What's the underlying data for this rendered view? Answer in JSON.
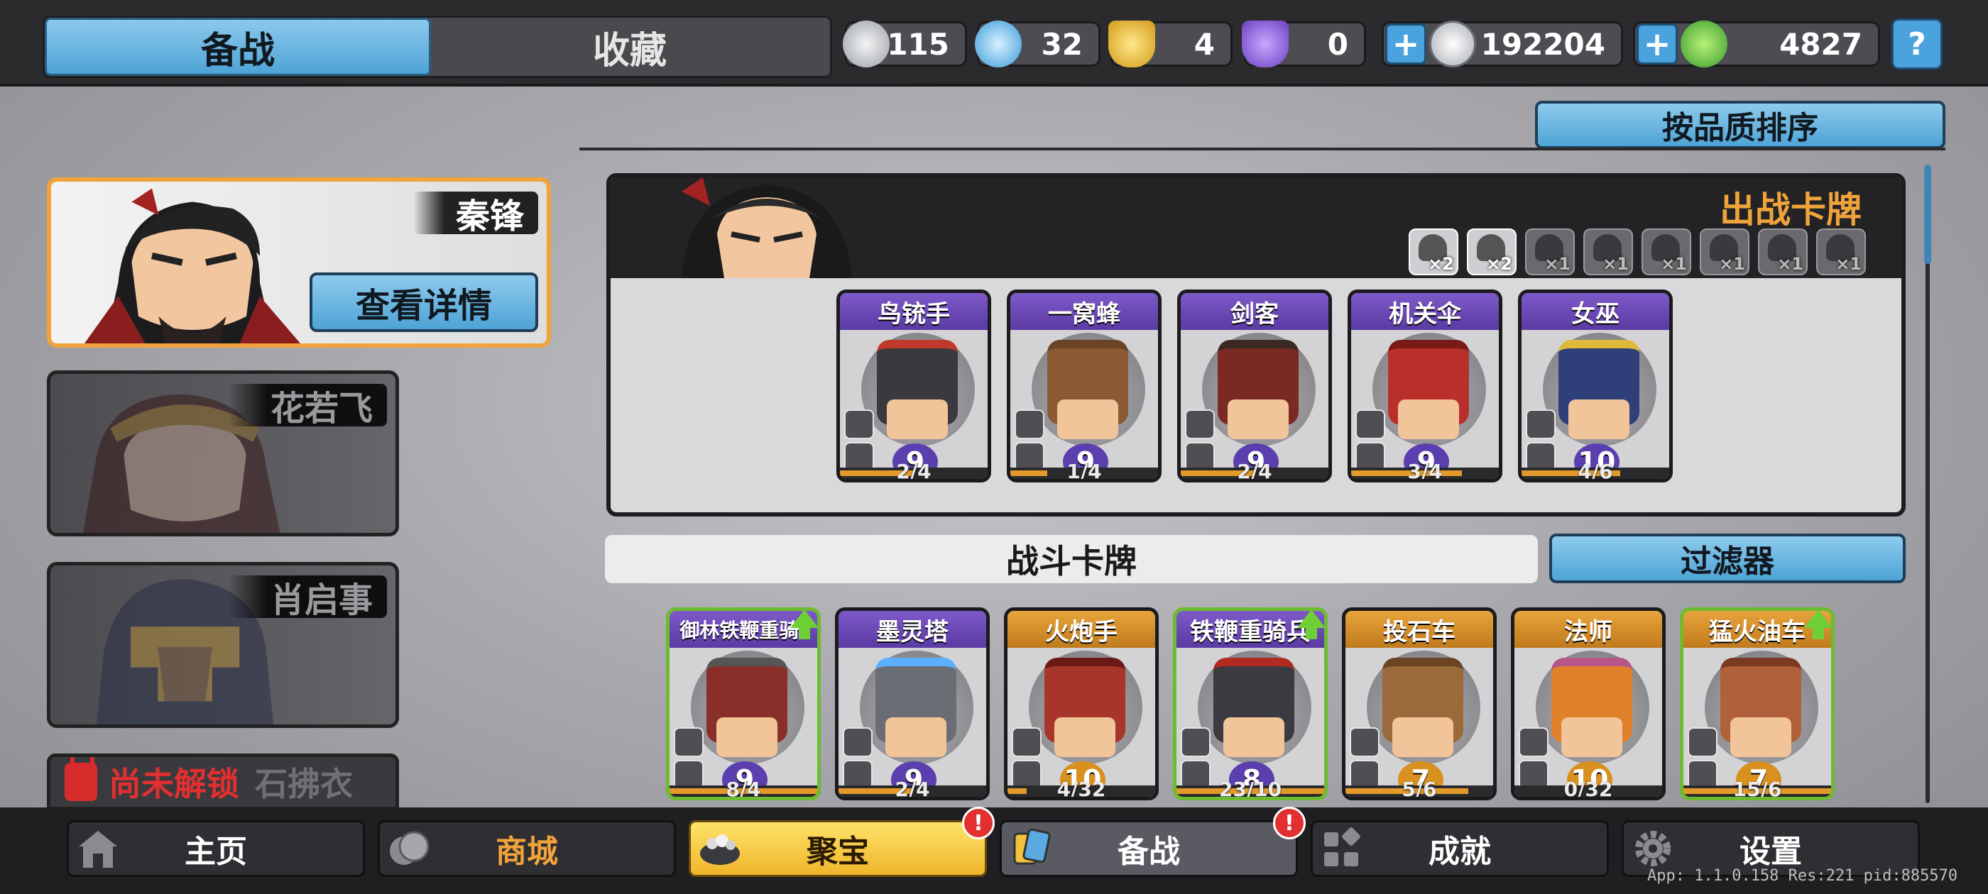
{
  "header": {
    "tabs": [
      {
        "label": "备战",
        "active": true
      },
      {
        "label": "收藏",
        "active": false
      }
    ],
    "resources": [
      {
        "icon": "silver-crystal-icon",
        "value": "115"
      },
      {
        "icon": "blue-crystal-icon",
        "value": "32"
      },
      {
        "icon": "gold-shield-icon",
        "value": "4"
      },
      {
        "icon": "purple-shield-icon",
        "value": "0"
      }
    ],
    "currencies": [
      {
        "icon": "silver-coin-icon",
        "value": "192204",
        "add_label": "+"
      },
      {
        "icon": "green-gem-icon",
        "value": "4827",
        "add_label": "+"
      }
    ],
    "help_label": "?"
  },
  "commanders": [
    {
      "name": "秦锋",
      "selected": true,
      "detail_button": "查看详情"
    },
    {
      "name": "花若飞",
      "selected": false
    },
    {
      "name": "肖启事",
      "selected": false
    }
  ],
  "locked_commander": {
    "status": "尚未解锁",
    "name": "石拂衣"
  },
  "sort_button": "按品质排序",
  "deck": {
    "title": "出战卡牌",
    "chips": [
      {
        "icon": "sword-trait-icon",
        "mult": "×2",
        "active": true
      },
      {
        "icon": "hat-trait-icon",
        "mult": "×2",
        "active": true
      },
      {
        "icon": "helmet-trait-icon",
        "mult": "×1",
        "active": false
      },
      {
        "icon": "skull-trait-icon",
        "mult": "×1",
        "active": false
      },
      {
        "icon": "gear-trait-icon",
        "mult": "×1",
        "active": false
      },
      {
        "icon": "burst-trait-icon",
        "mult": "×1",
        "active": false
      },
      {
        "icon": "blade-trait-icon",
        "mult": "×1",
        "active": false
      },
      {
        "icon": "shield-trait-icon",
        "mult": "×1",
        "active": false
      }
    ],
    "cards": [
      {
        "name": "鸟铳手",
        "level": "9",
        "count": "2/4",
        "progress": 0.5
      },
      {
        "name": "一窝蜂",
        "level": "9",
        "count": "1/4",
        "progress": 0.25
      },
      {
        "name": "剑客",
        "level": "9",
        "count": "2/4",
        "progress": 0.5
      },
      {
        "name": "机关伞",
        "level": "9",
        "count": "3/4",
        "progress": 0.75
      },
      {
        "name": "女巫",
        "level": "10",
        "count": "4/6",
        "progress": 0.67
      }
    ]
  },
  "battle_cards": {
    "title": "战斗卡牌",
    "filter_button": "过滤器",
    "cards": [
      {
        "name": "御林铁鞭重骑:",
        "level": "9",
        "count": "8/4",
        "progress": 1.0,
        "upgrade": true,
        "rarity": "purple"
      },
      {
        "name": "墨灵塔",
        "level": "9",
        "count": "2/4",
        "progress": 0.5,
        "upgrade": false,
        "rarity": "purple"
      },
      {
        "name": "火炮手",
        "level": "10",
        "count": "4/32",
        "progress": 0.13,
        "upgrade": false,
        "rarity": "orange"
      },
      {
        "name": "铁鞭重骑兵",
        "level": "8",
        "count": "23/10",
        "progress": 1.0,
        "upgrade": true,
        "rarity": "purple"
      },
      {
        "name": "投石车",
        "level": "7",
        "count": "5/6",
        "progress": 0.83,
        "upgrade": false,
        "rarity": "orange"
      },
      {
        "name": "法师",
        "level": "10",
        "count": "0/32",
        "progress": 0.0,
        "upgrade": false,
        "rarity": "orange"
      },
      {
        "name": "猛火油车",
        "level": "7",
        "count": "15/6",
        "progress": 1.0,
        "upgrade": true,
        "rarity": "orange"
      }
    ]
  },
  "bottom_nav": [
    {
      "label": "主页",
      "icon": "home-icon"
    },
    {
      "label": "商城",
      "icon": "coins-icon"
    },
    {
      "label": "聚宝",
      "icon": "treasure-bowl-icon",
      "alert": "!"
    },
    {
      "label": "备战",
      "icon": "cards-icon",
      "alert": "!"
    },
    {
      "label": "成就",
      "icon": "grid-icon"
    },
    {
      "label": "设置",
      "icon": "gear-icon"
    }
  ],
  "version_text": "App: 1.1.0.158 Res:221 pid:885570",
  "colors": {
    "accent_blue": "#4ea3d6",
    "gold": "#f0a33a",
    "rare_purple": "#5b3fae",
    "epic_orange": "#d8901f",
    "upgrade_green": "#6fcf36",
    "alert_red": "#e23030"
  }
}
